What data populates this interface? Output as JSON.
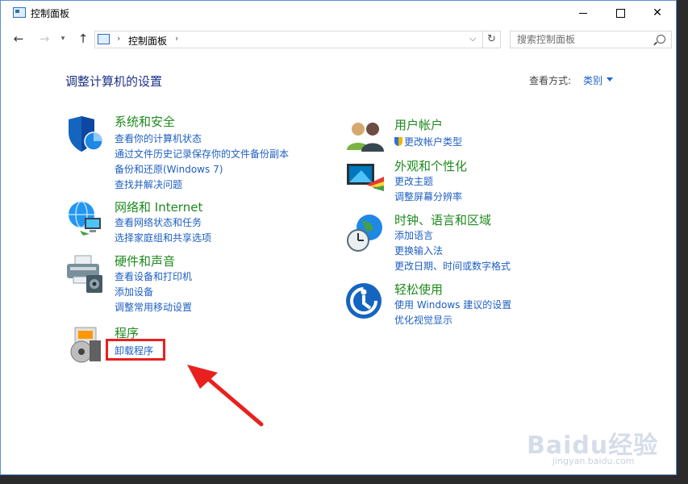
{
  "window": {
    "title": "控制面板",
    "min_label": "",
    "max_label": "",
    "close_label": "✕"
  },
  "nav": {
    "back": "←",
    "forward": "→",
    "recent": "▾",
    "up": "↑",
    "breadcrumb": "控制面板",
    "sep": "›",
    "dropdown": "⌵",
    "refresh": "↻"
  },
  "search": {
    "placeholder": "搜索控制面板"
  },
  "main": {
    "heading": "调整计算机的设置",
    "view_by_label": "查看方式:",
    "view_by_value": "类别"
  },
  "categories_left": [
    {
      "title": "系统和安全",
      "links": [
        "查看你的计算机状态",
        "通过文件历史记录保存你的文件备份副本",
        "备份和还原(Windows 7)",
        "查找并解决问题"
      ]
    },
    {
      "title": "网络和 Internet",
      "links": [
        "查看网络状态和任务",
        "选择家庭组和共享选项"
      ]
    },
    {
      "title": "硬件和声音",
      "links": [
        "查看设备和打印机",
        "添加设备",
        "调整常用移动设置"
      ]
    },
    {
      "title": "程序",
      "links": [
        "卸载程序"
      ]
    }
  ],
  "categories_right": [
    {
      "title": "用户帐户",
      "links": [
        "更改帐户类型"
      ]
    },
    {
      "title": "外观和个性化",
      "links": [
        "更改主题",
        "调整屏幕分辨率"
      ]
    },
    {
      "title": "时钟、语言和区域",
      "links": [
        "添加语言",
        "更换输入法",
        "更改日期、时间或数字格式"
      ]
    },
    {
      "title": "轻松使用",
      "links": [
        "使用 Windows 建议的设置",
        "优化视觉显示"
      ]
    }
  ],
  "watermark": {
    "brand": "Baidu经验",
    "url": "jingyan.baidu.com"
  },
  "colors": {
    "category_title": "#1d8a1d",
    "link": "#1e5fc2",
    "heading": "#1e3287",
    "highlight_box": "#e8211f",
    "arrow": "#e8211f"
  }
}
